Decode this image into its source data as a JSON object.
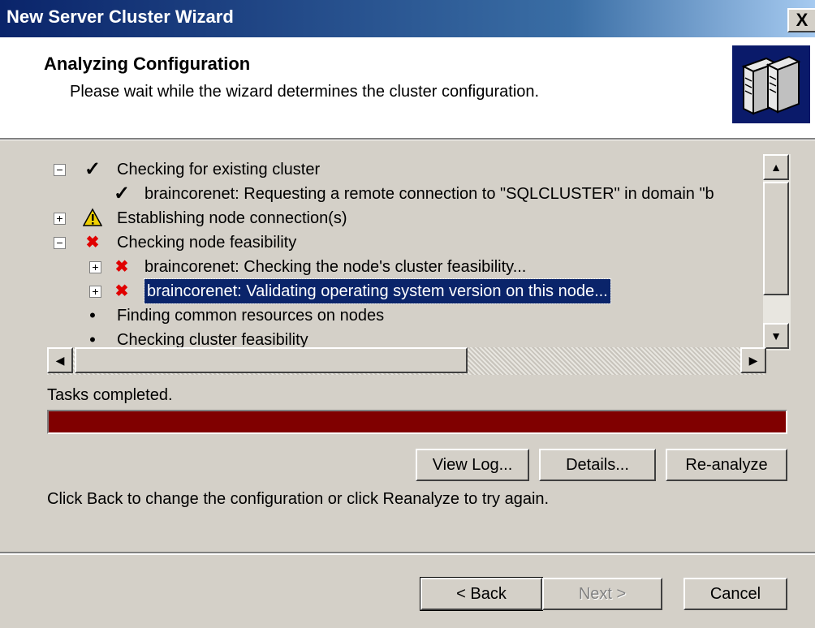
{
  "window": {
    "title": "New Server Cluster Wizard",
    "close_label": "X"
  },
  "header": {
    "title": "Analyzing Configuration",
    "subtitle": "Please wait while the wizard determines the cluster configuration.",
    "logo_icon": "server-cluster-icon"
  },
  "tree": {
    "items": [
      {
        "expander": "−",
        "status": "check",
        "label": "Checking for existing cluster",
        "selected": false
      },
      {
        "expander": "",
        "status": "check",
        "label": "braincorenet: Requesting a remote connection to \"SQLCLUSTER\" in domain \"b",
        "selected": false
      },
      {
        "expander": "+",
        "status": "warning",
        "label": "Establishing node connection(s)",
        "selected": false
      },
      {
        "expander": "−",
        "status": "error",
        "label": "Checking node feasibility",
        "selected": false
      },
      {
        "expander": "+",
        "status": "error",
        "label": "braincorenet: Checking the node's cluster feasibility...",
        "selected": false
      },
      {
        "expander": "+",
        "status": "error",
        "label": "braincorenet: Validating operating system version on this node...",
        "selected": true
      },
      {
        "expander": "",
        "status": "pending",
        "label": "Finding common resources on nodes",
        "selected": false
      },
      {
        "expander": "",
        "status": "pending",
        "label": "Checking cluster feasibility",
        "selected": false
      }
    ]
  },
  "status_text": "Tasks completed.",
  "progress": {
    "fraction": 1.0,
    "color": "#800000"
  },
  "action_buttons": {
    "view_log": "View Log...",
    "details": "Details...",
    "reanalyze": "Re-analyze"
  },
  "instruction": "Click Back to change the configuration or click Reanalyze to try again.",
  "nav_buttons": {
    "back": "< Back",
    "next": "Next >",
    "cancel": "Cancel"
  },
  "colors": {
    "title_bar": "#0a246a",
    "selection": "#0a246a",
    "error": "#e00000",
    "warning": "#f0d000"
  }
}
